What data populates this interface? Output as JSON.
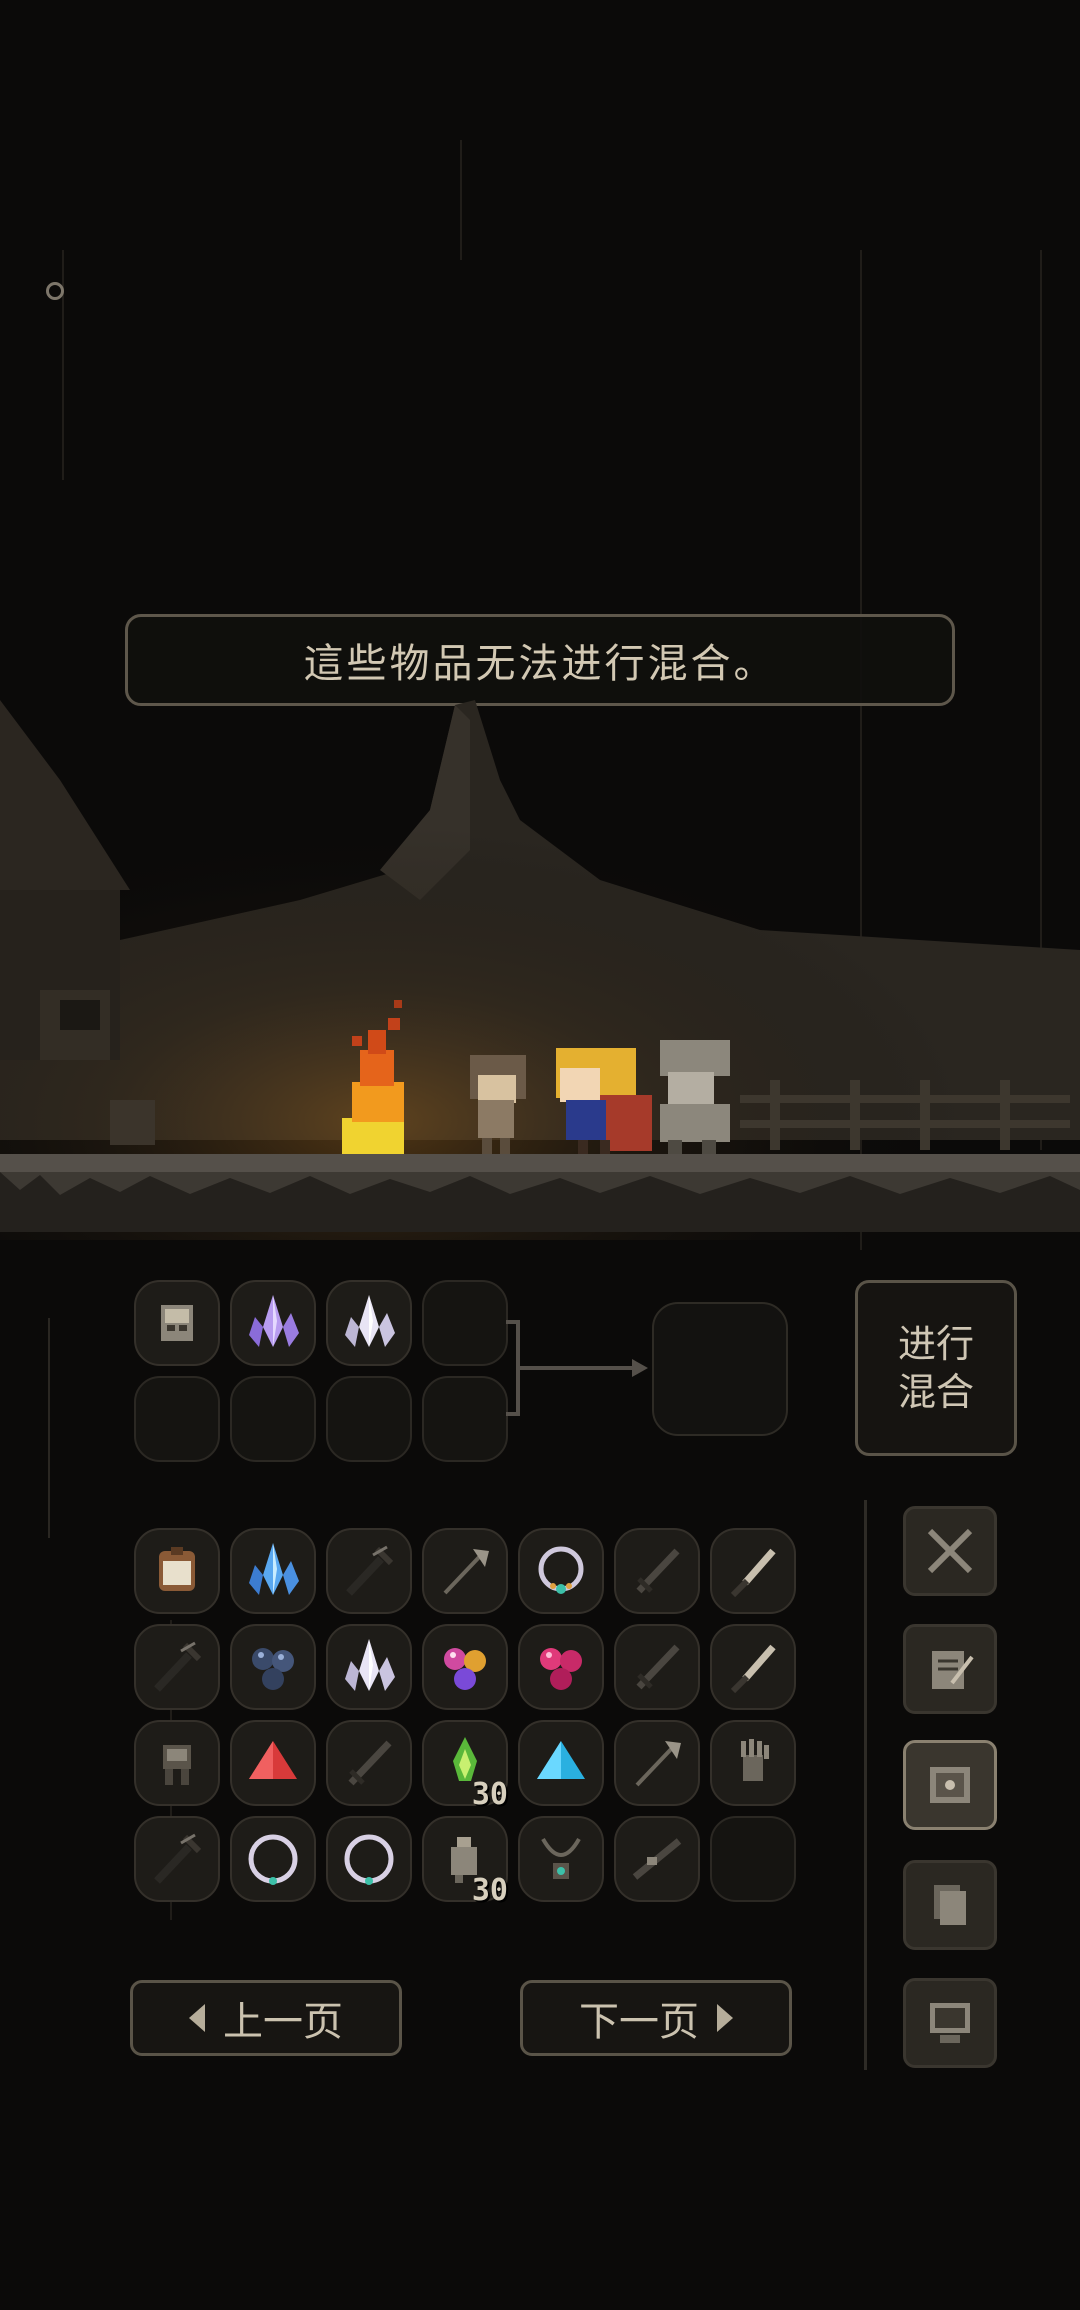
{
  "message": "這些物品无法进行混合。",
  "craft": {
    "mix_label_line1": "进行",
    "mix_label_line2": "混合",
    "input_items": [
      "skull-rock-icon",
      "purple-crystal-icon",
      "white-crystal-icon",
      "",
      "",
      "",
      "",
      ""
    ]
  },
  "inventory": {
    "rows": [
      [
        {
          "icon": "bread-icon"
        },
        {
          "icon": "blue-crystal-icon"
        },
        {
          "icon": "trident-icon"
        },
        {
          "icon": "halberd-icon"
        },
        {
          "icon": "necklace-icon"
        },
        {
          "icon": "sword-icon"
        },
        {
          "icon": "dagger-icon"
        }
      ],
      [
        {
          "icon": "trident-icon"
        },
        {
          "icon": "dark-orbs-icon"
        },
        {
          "icon": "white-crystal-icon"
        },
        {
          "icon": "rainbow-orbs-icon"
        },
        {
          "icon": "pink-orbs-icon"
        },
        {
          "icon": "sword-icon"
        },
        {
          "icon": "dagger-icon"
        }
      ],
      [
        {
          "icon": "armor-icon"
        },
        {
          "icon": "red-pyramid-icon"
        },
        {
          "icon": "sword-icon"
        },
        {
          "icon": "green-flame-icon",
          "count": "30"
        },
        {
          "icon": "blue-pyramid-icon"
        },
        {
          "icon": "halberd-icon"
        },
        {
          "icon": "skeleton-hand-icon"
        }
      ],
      [
        {
          "icon": "trident-icon"
        },
        {
          "icon": "ring-icon"
        },
        {
          "icon": "ring-icon"
        },
        {
          "icon": "bone-icon",
          "count": "30"
        },
        {
          "icon": "amulet-icon"
        },
        {
          "icon": "rifle-icon"
        },
        {
          "icon": ""
        }
      ]
    ]
  },
  "nav": {
    "prev_label": "上一页",
    "next_label": "下一页"
  },
  "side_tabs": [
    "swords-icon",
    "scroll-icon",
    "map-icon",
    "documents-icon",
    "computer-icon"
  ],
  "side_active": "map-icon",
  "colors": {
    "background": "#0b0a09",
    "panel_border": "#5a5448",
    "text": "#cfc6b4",
    "fire": "#f29a1e"
  }
}
